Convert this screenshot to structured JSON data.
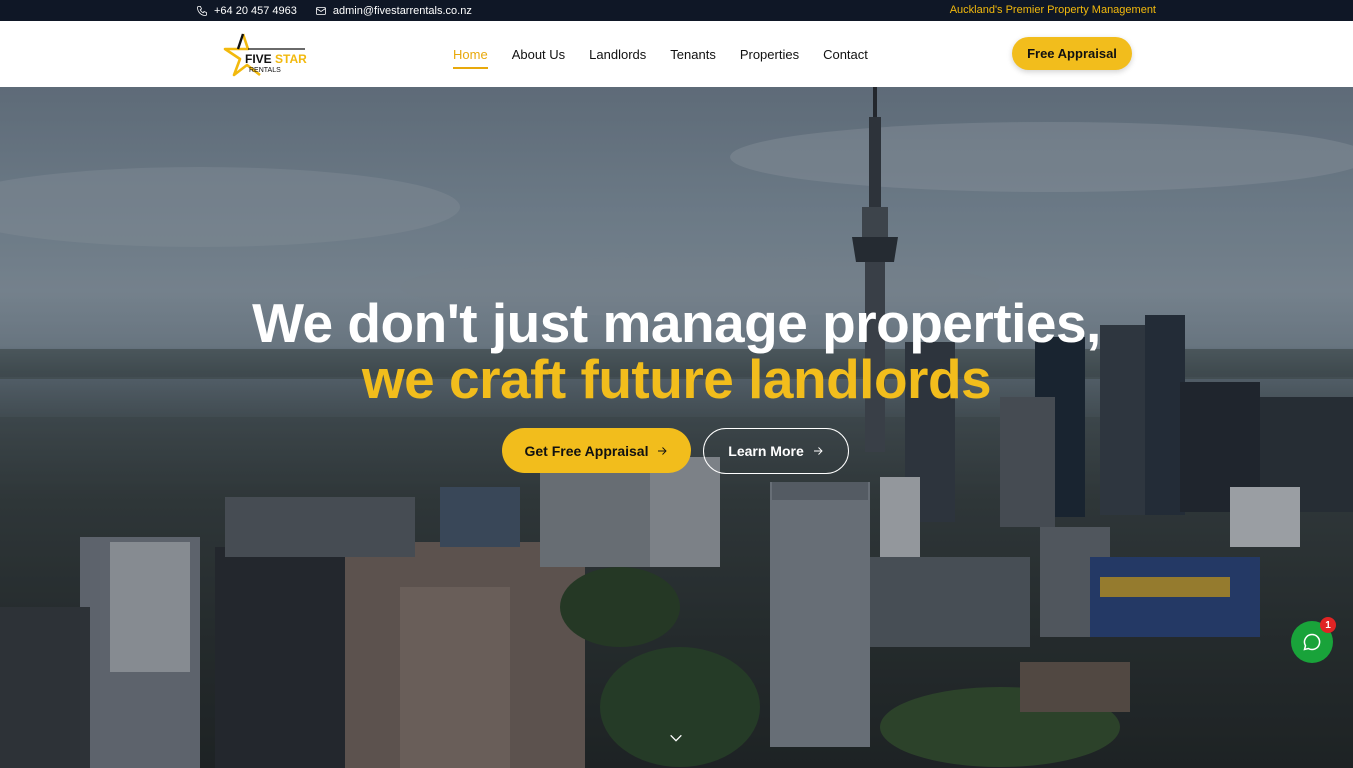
{
  "topbar": {
    "phone": "+64 20 457 4963",
    "email": "admin@fivestarrentals.co.nz",
    "tagline": "Auckland's Premier Property Management"
  },
  "header": {
    "logo": {
      "word1": "FIVE",
      "word2": "STAR",
      "sub": "RENTALS"
    },
    "nav": [
      {
        "label": "Home",
        "active": true
      },
      {
        "label": "About Us",
        "active": false
      },
      {
        "label": "Landlords",
        "active": false
      },
      {
        "label": "Tenants",
        "active": false
      },
      {
        "label": "Properties",
        "active": false
      },
      {
        "label": "Contact",
        "active": false
      }
    ],
    "cta_label": "Free Appraisal"
  },
  "hero": {
    "headline_line1": "We don't just manage properties,",
    "headline_line2": "we craft future landlords",
    "primary_button": "Get Free Appraisal",
    "secondary_button": "Learn More"
  },
  "chat": {
    "badge_count": "1"
  },
  "colors": {
    "accent": "#f2bd1c",
    "dark": "#0f1726",
    "chat_green": "#19a33a"
  },
  "icons": [
    "phone-icon",
    "mail-icon",
    "arrow-right-icon",
    "chevron-down-icon",
    "chat-icon"
  ]
}
